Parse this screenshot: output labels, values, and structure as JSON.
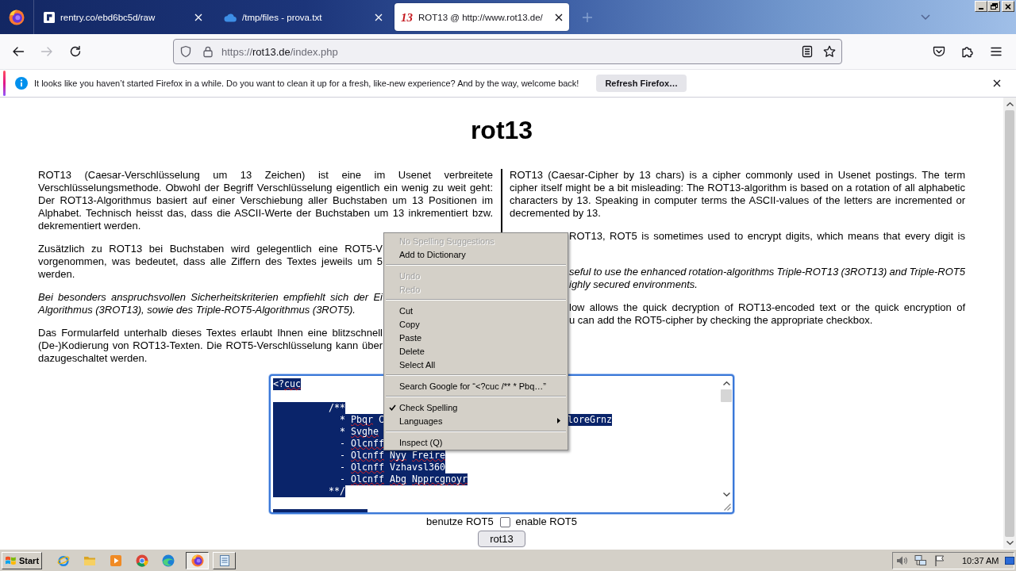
{
  "browser": {
    "tabs": [
      {
        "kind": "block_logo",
        "title": "rentry.co/ebd6bc5d/raw",
        "selected": false
      },
      {
        "kind": "cloud",
        "title": "/tmp/files - prova.txt",
        "selected": false
      },
      {
        "kind": "text_logo",
        "favicon_text": "13",
        "title": "ROT13 @ http://www.rot13.de/",
        "selected": true
      }
    ],
    "nav": {
      "buttons": [
        {
          "kind": "back",
          "disabled": false
        },
        {
          "kind": "forward",
          "disabled": true
        },
        {
          "kind": "reload",
          "disabled": false
        }
      ]
    },
    "address": {
      "scheme": "https://",
      "host": "rot13.de",
      "path": "/index.php"
    },
    "notification": {
      "message": "It looks like you haven’t started Firefox in a while. Do you want to clean it up for a fresh, like-new experience? And by the way, welcome back!",
      "button": "Refresh Firefox…"
    }
  },
  "page": {
    "title": "rot13",
    "columns": [
      {
        "paragraphs": [
          {
            "kind": "text",
            "italic": false,
            "text": "ROT13 (Caesar-Verschlüsselung um 13 Zeichen) ist eine im Usenet verbreitete Verschlüsselungsmethode. Obwohl der Begriff Verschlüsselung eigentlich ein wenig zu weit geht: Der ROT13-Algorithmus basiert auf einer Verschiebung aller Buchstaben um 13 Positionen im Alphabet. Technisch heisst das, dass die ASCII-Werte der Buchstaben um 13 inkrementiert bzw. dekrementiert werden."
          },
          {
            "kind": "lines",
            "italic": false,
            "lines": [
              {
                "kind": "cut_right",
                "text": "Zusätzlich zu ROT13 bei Buchstaben wird gelegentlich eine ROT5-V"
              },
              {
                "kind": "cut_right",
                "text": "vorgenommen, was bedeutet, dass alle Ziffern des Textes jeweils um 5"
              },
              {
                "kind": "last",
                "text": "werden."
              }
            ]
          },
          {
            "kind": "lines",
            "italic": true,
            "lines": [
              {
                "kind": "cut_right",
                "text": "Bei besonders anspruchsvollen Sicherheitskriterien empfiehlt sich der Ei"
              },
              {
                "kind": "last",
                "text": "Algorithmus (3ROT13), sowie des Triple-ROT5-Algorithmus (3ROT5)."
              }
            ]
          },
          {
            "kind": "lines",
            "italic": false,
            "lines": [
              {
                "kind": "cut_right",
                "text": "Das Formularfeld unterhalb dieses Textes erlaubt Ihnen eine blitzschnell"
              },
              {
                "kind": "cut_right",
                "text": "(De-)Kodierung von ROT13-Texten. Die ROT5-Verschlüsselung kann über"
              },
              {
                "kind": "last",
                "text": "dazugeschaltet werden."
              }
            ]
          }
        ]
      },
      {
        "paragraphs": [
          {
            "kind": "text",
            "italic": false,
            "text": "ROT13 (Caesar-Cipher by 13 chars) is a cipher commonly used in Usenet postings. The term cipher itself might be a bit misleading: The ROT13-algorithm is based on a rotation of all alphabetic characters by 13. Speaking in computer terms the ASCII-values of the letters are incremented or decremented by 13."
          },
          {
            "kind": "lines",
            "italic": false,
            "lines": [
              {
                "kind": "cut_left",
                "text": "ROT13, ROT5 is sometimes used to encrypt digits, which means that every digit is"
              }
            ]
          },
          {
            "kind": "lines",
            "italic": true,
            "lines": [
              {
                "kind": "cut_left",
                "text": "seful to use the enhanced rotation-algorithms Triple-ROT13 (3ROT13) and Triple-ROT5"
              },
              {
                "kind": "cut_left_last",
                "text": "ighly secured environments."
              }
            ]
          },
          {
            "kind": "lines",
            "italic": false,
            "lines": [
              {
                "kind": "cut_left",
                "text": "low allows the quick decryption of ROT13-encoded text or the quick encryption of"
              },
              {
                "kind": "cut_left_last",
                "text": "u can add the ROT5-cipher by checking the appropriate checkbox."
              }
            ]
          }
        ]
      }
    ],
    "form": {
      "textarea": {
        "text": "<?cuc\n\n          /**\n            * Pbqr C\tloreGrnz\n            * Svghe \n            - Olcnff \n            - Olcnff Nyy Freire\n            - Olcnff Vzhavsl360\n            - Olcnff Abg Npprcgnoyr\n          **/",
        "selected": true,
        "spellcheck": true
      },
      "checkbox": {
        "label_before": "benutze ROT5",
        "checked": false,
        "label_after": "enable ROT5"
      },
      "button": "rot13"
    }
  },
  "context_menu": {
    "groups": [
      {
        "items": [
          {
            "label": "No Spelling Suggestions",
            "disabled": true,
            "checked": false,
            "submenu": false
          },
          {
            "label": "Add to Dictionary",
            "disabled": false,
            "checked": false,
            "submenu": false
          }
        ]
      },
      {
        "items": [
          {
            "label": "Undo",
            "disabled": true,
            "checked": false,
            "submenu": false
          },
          {
            "label": "Redo",
            "disabled": true,
            "checked": false,
            "submenu": false
          }
        ]
      },
      {
        "items": [
          {
            "label": "Cut",
            "disabled": false,
            "checked": false,
            "submenu": false
          },
          {
            "label": "Copy",
            "disabled": false,
            "checked": false,
            "submenu": false
          },
          {
            "label": "Paste",
            "disabled": false,
            "checked": false,
            "submenu": false
          },
          {
            "label": "Delete",
            "disabled": false,
            "checked": false,
            "submenu": false
          },
          {
            "label": "Select All",
            "disabled": false,
            "checked": false,
            "submenu": false
          }
        ]
      },
      {
        "items": [
          {
            "label": "Search Google for “<?cuc /** * Pbq…”",
            "disabled": false,
            "checked": false,
            "submenu": false
          }
        ]
      },
      {
        "items": [
          {
            "label": "Check Spelling",
            "disabled": false,
            "checked": true,
            "submenu": false
          },
          {
            "label": "Languages",
            "disabled": false,
            "checked": false,
            "submenu": true
          }
        ]
      },
      {
        "items": [
          {
            "label": "Inspect (Q)",
            "disabled": false,
            "checked": false,
            "submenu": false
          }
        ]
      }
    ]
  },
  "taskbar": {
    "start": "Start",
    "windows": [
      {
        "kind": "fox",
        "selected": true
      },
      {
        "kind": "notepad",
        "selected": false
      }
    ],
    "clock": "10:37 AM"
  }
}
